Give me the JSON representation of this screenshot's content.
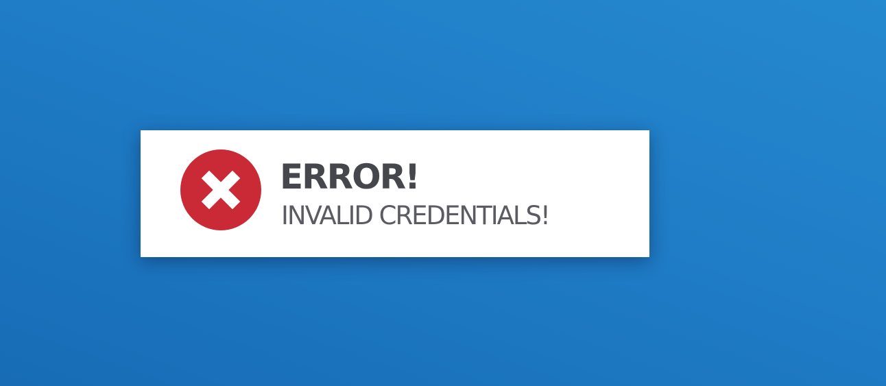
{
  "alert": {
    "title": "ERROR!",
    "message": "INVALID CREDENTIALS!",
    "icon": "error-x-icon"
  },
  "colors": {
    "background": "#1f7cc6",
    "alert_background": "#ffffff",
    "error_red": "#c92a36",
    "title_text": "#46464d",
    "message_text": "#5b5b62"
  }
}
